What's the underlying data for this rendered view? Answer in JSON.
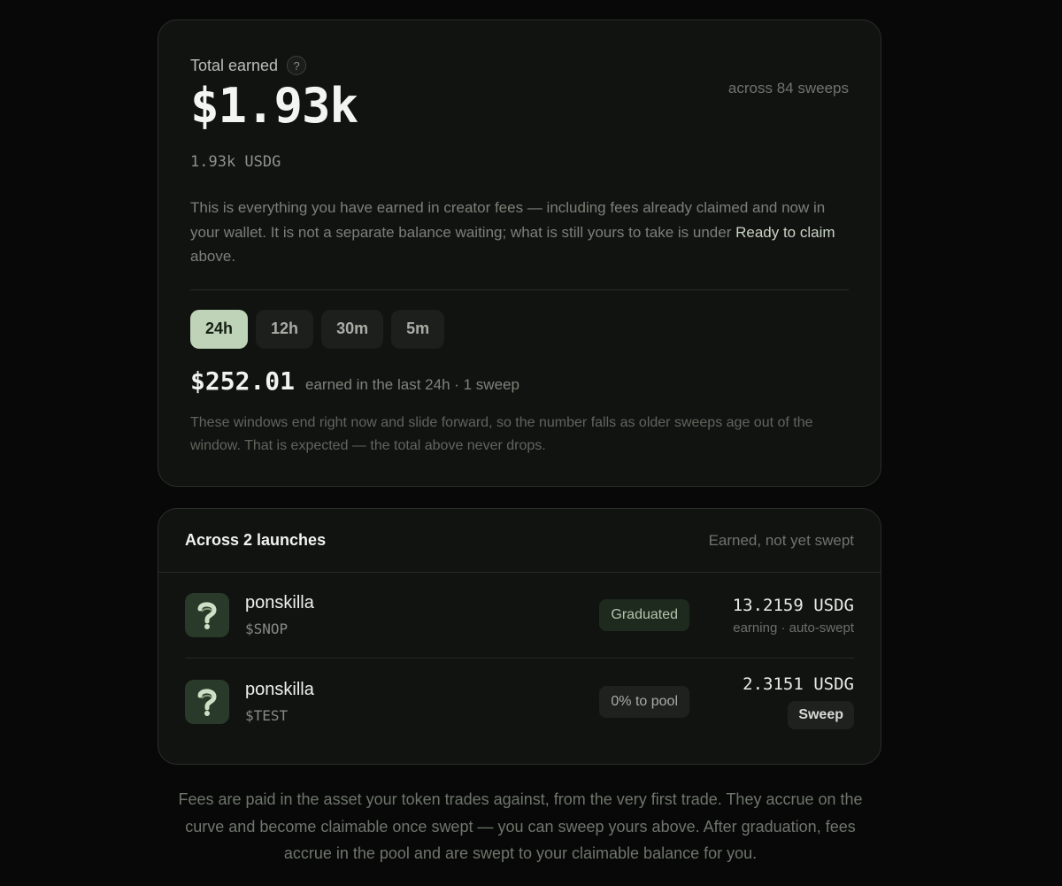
{
  "earned": {
    "label": "Total earned",
    "help": "?",
    "sweeps_count": "across 84 sweeps",
    "amount": "$1.93k",
    "amount_usdg": "1.93k USDG",
    "desc_part1": "This is everything you have earned in creator fees — including fees already claimed and now in your wallet. It is not a separate balance waiting; what is still yours to take is under ",
    "desc_highlight": "Ready to claim",
    "desc_part2": " above.",
    "windows": [
      "24h",
      "12h",
      "30m",
      "5m"
    ],
    "active_window": "24h",
    "period_amount": "$252.01",
    "period_text": "earned in the last 24h · 1 sweep",
    "note": "These windows end right now and slide forward, so the number falls as older sweeps age out of the window. That is expected — the total above never drops."
  },
  "launches": {
    "title": "Across 2 launches",
    "subtitle": "Earned, not yet swept",
    "items": [
      {
        "name": "ponskilla",
        "ticker": "$SNOP",
        "badge": "Graduated",
        "amount": "13.2159 USDG",
        "status": "earning · auto-swept"
      },
      {
        "name": "ponskilla",
        "ticker": "$TEST",
        "badge": "0% to pool",
        "amount": "2.3151 USDG",
        "action": "Sweep"
      }
    ]
  },
  "footer": "Fees are paid in the asset your token trades against, from the very first trade. They accrue on the curve and become claimable once swept — you can sweep yours above. After graduation, fees accrue in the pool and are swept to your claimable balance for you.",
  "colors": {
    "accent": "#bfd3b8",
    "background": "#070807",
    "card": "#111311"
  }
}
